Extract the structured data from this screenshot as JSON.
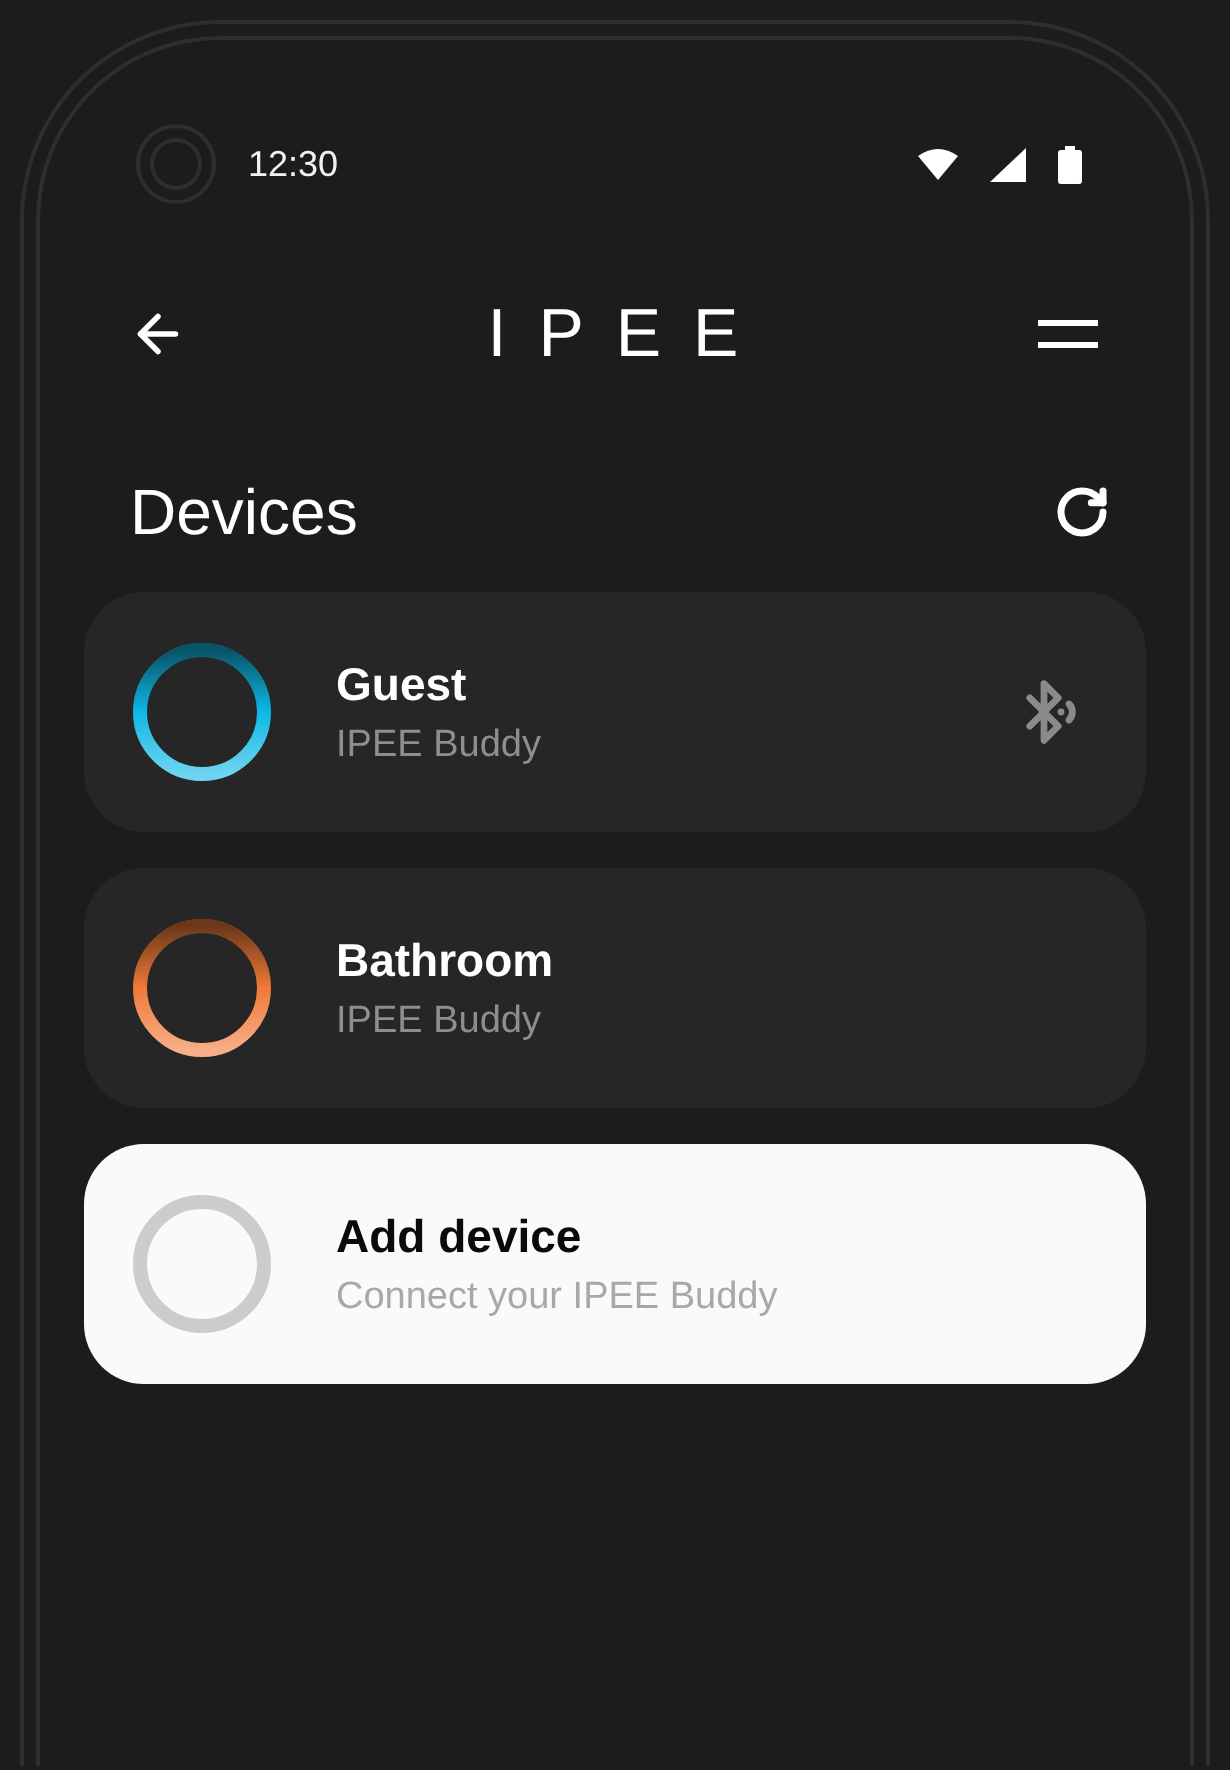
{
  "status_bar": {
    "time": "12:30"
  },
  "header": {
    "logo": "IPEE"
  },
  "section": {
    "title": "Devices"
  },
  "devices": [
    {
      "kind": "connected",
      "color": "#0fb8e6",
      "name": "Guest",
      "model": "IPEE Buddy"
    },
    {
      "kind": "device",
      "color": "#f07a38",
      "name": "Bathroom",
      "model": "IPEE Buddy"
    },
    {
      "kind": "add",
      "color": "#cccccc",
      "name": "Add device",
      "model": "Connect your IPEE Buddy"
    }
  ]
}
